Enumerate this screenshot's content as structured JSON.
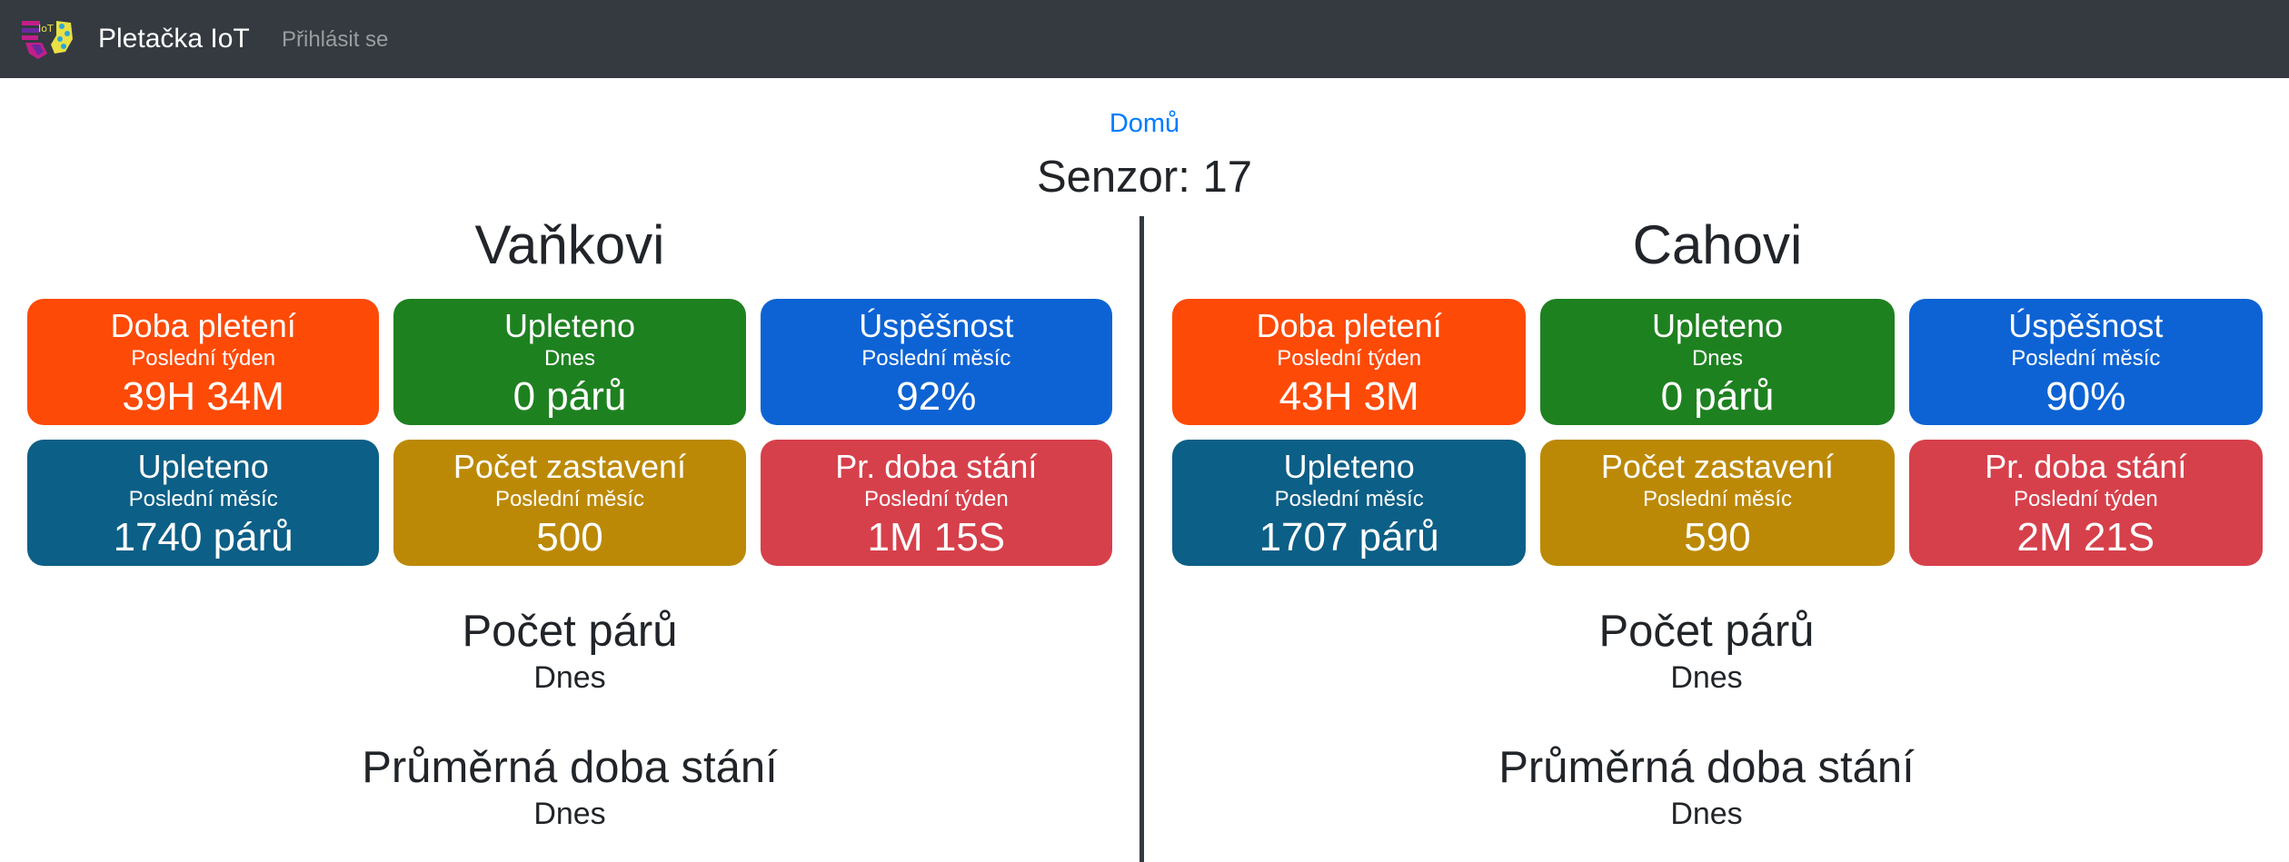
{
  "navbar": {
    "brand": "Pletačka IoT",
    "login": "Přihlásit se",
    "logo_text": "IoT"
  },
  "home_link": "Domů",
  "sensor_title": "Senzor: 17",
  "colors": {
    "orange": "#fe4a07",
    "green": "#1e8120",
    "blue": "#0d63d4",
    "teal": "#0c5f86",
    "gold": "#bc8906",
    "red": "#d6404b",
    "navbar": "#343a40",
    "link": "#007bff"
  },
  "left": {
    "name": "Vaňkovi",
    "cards": [
      {
        "title": "Doba pletení",
        "sub": "Poslední týden",
        "value": "39H 34M",
        "color": "orange"
      },
      {
        "title": "Upleteno",
        "sub": "Dnes",
        "value": "0 párů",
        "color": "green"
      },
      {
        "title": "Úspěšnost",
        "sub": "Poslední měsíc",
        "value": "92%",
        "color": "blue"
      },
      {
        "title": "Upleteno",
        "sub": "Poslední měsíc",
        "value": "1740 párů",
        "color": "teal"
      },
      {
        "title": "Počet zastavení",
        "sub": "Poslední měsíc",
        "value": "500",
        "color": "gold"
      },
      {
        "title": "Pr. doba stání",
        "sub": "Poslední týden",
        "value": "1M 15S",
        "color": "red"
      }
    ],
    "pairs_title": "Počet párů",
    "pairs_sub": "Dnes",
    "avg_title": "Průměrná doba stání",
    "avg_sub": "Dnes"
  },
  "right": {
    "name": "Cahovi",
    "cards": [
      {
        "title": "Doba pletení",
        "sub": "Poslední týden",
        "value": "43H 3M",
        "color": "orange"
      },
      {
        "title": "Upleteno",
        "sub": "Dnes",
        "value": "0 párů",
        "color": "green"
      },
      {
        "title": "Úspěšnost",
        "sub": "Poslední měsíc",
        "value": "90%",
        "color": "blue"
      },
      {
        "title": "Upleteno",
        "sub": "Poslední měsíc",
        "value": "1707 párů",
        "color": "teal"
      },
      {
        "title": "Počet zastavení",
        "sub": "Poslední měsíc",
        "value": "590",
        "color": "gold"
      },
      {
        "title": "Pr. doba stání",
        "sub": "Poslední týden",
        "value": "2M 21S",
        "color": "red"
      }
    ],
    "pairs_title": "Počet párů",
    "pairs_sub": "Dnes",
    "avg_title": "Průměrná doba stání",
    "avg_sub": "Dnes"
  }
}
